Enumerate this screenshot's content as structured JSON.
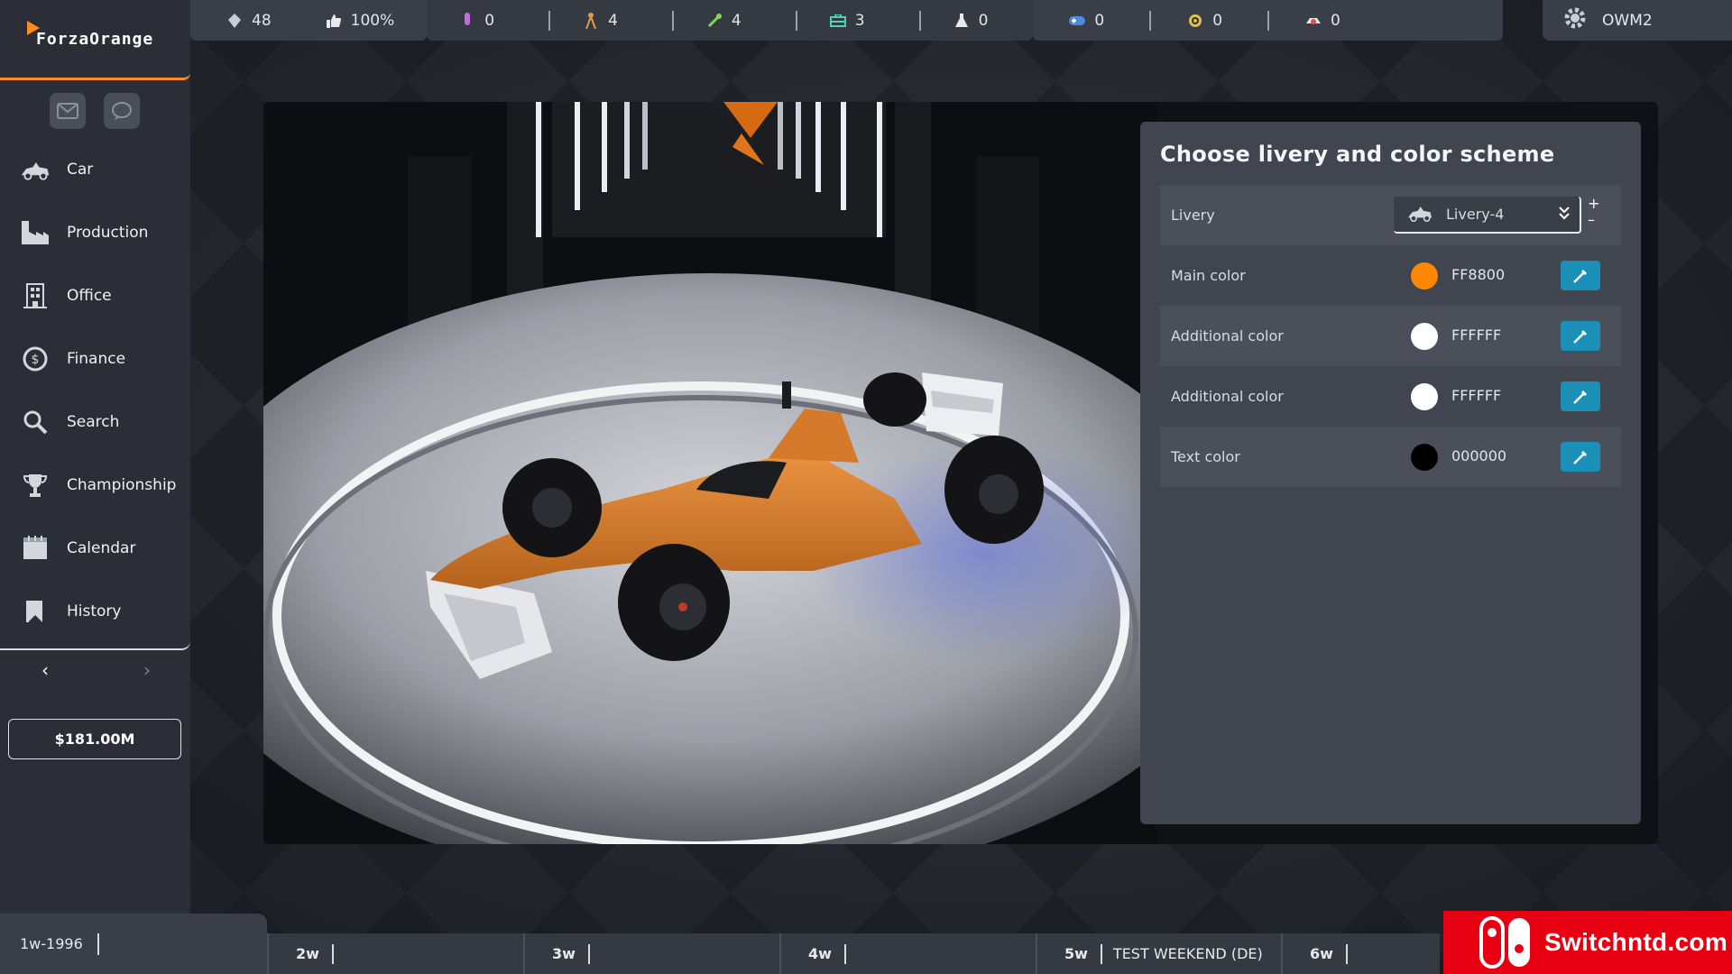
{
  "app": {
    "logo": "ForzaOrange"
  },
  "topbar": {
    "stats": [
      {
        "icon": "diamond-icon",
        "value": "48"
      },
      {
        "icon": "thumbs-up-icon",
        "value": "100%"
      },
      {
        "icon": "test-tube-icon",
        "value": "0"
      },
      {
        "icon": "engineer-icon",
        "value": "4"
      },
      {
        "icon": "wrench-icon",
        "value": "4"
      },
      {
        "icon": "toolbox-icon",
        "value": "3"
      },
      {
        "icon": "flask-icon",
        "value": "0"
      },
      {
        "icon": "gamepad-icon",
        "value": "0"
      },
      {
        "icon": "tire-icon",
        "value": "0"
      },
      {
        "icon": "car-part-icon",
        "value": "0"
      }
    ],
    "user": "OWM2"
  },
  "sidebar": {
    "items": [
      {
        "label": "Car",
        "icon": "car-icon"
      },
      {
        "label": "Production",
        "icon": "factory-icon"
      },
      {
        "label": "Office",
        "icon": "building-icon"
      },
      {
        "label": "Finance",
        "icon": "dollar-coin-icon"
      },
      {
        "label": "Search",
        "icon": "magnifier-icon"
      },
      {
        "label": "Championship",
        "icon": "trophy-icon"
      },
      {
        "label": "Calendar",
        "icon": "calendar-icon"
      },
      {
        "label": "History",
        "icon": "bookmark-icon"
      }
    ],
    "balance": "$181.00M"
  },
  "panel": {
    "title": "Choose livery and color scheme",
    "livery": {
      "label": "Livery",
      "value": "Livery-4"
    },
    "colors": [
      {
        "label": "Main color",
        "hex": "FF8800",
        "swatch": "#FF8800"
      },
      {
        "label": "Additional color",
        "hex": "FFFFFF",
        "swatch": "#FFFFFF"
      },
      {
        "label": "Additional color",
        "hex": "FFFFFF",
        "swatch": "#FFFFFF"
      },
      {
        "label": "Text color",
        "hex": "000000",
        "swatch": "#000000"
      }
    ]
  },
  "timeline": {
    "current": "1w-1996",
    "weeks": [
      {
        "label": "2w",
        "event": ""
      },
      {
        "label": "3w",
        "event": ""
      },
      {
        "label": "4w",
        "event": ""
      },
      {
        "label": "5w",
        "event": "TEST WEEKEND (DE)"
      },
      {
        "label": "6w",
        "event": ""
      }
    ]
  },
  "watermark": "Switchntd.com",
  "colors": {
    "accent": "#FF8A1E",
    "picker": "#1A8FB8",
    "brand_red": "#E60012"
  }
}
